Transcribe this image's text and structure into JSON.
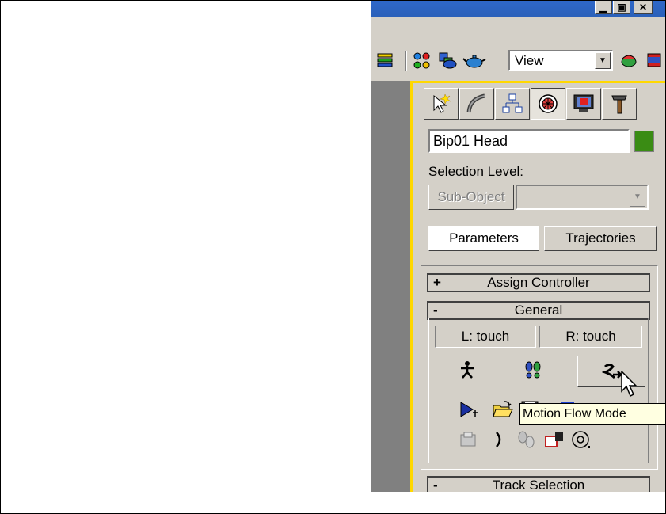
{
  "window": {
    "minimize_glyph": "▁",
    "maximize_glyph": "▣",
    "close_glyph": "✕"
  },
  "toolbar": {
    "view_dropdown": {
      "selected": "View"
    },
    "icons": [
      "layers-icon",
      "schematic-view-icon",
      "material-editor-icon",
      "render-scene-icon",
      "quick-render-icon",
      "render-last-icon"
    ]
  },
  "command_panel": {
    "tabs": [
      "create-tab",
      "modify-tab",
      "hierarchy-tab",
      "motion-tab",
      "display-tab",
      "utilities-tab"
    ],
    "active_tab": "motion-tab",
    "object_name": "Bip01 Head",
    "object_color": "#3a8c14",
    "selection_level_label": "Selection Level:",
    "sub_object_label": "Sub-Object",
    "parameters_label": "Parameters",
    "trajectories_label": "Trajectories",
    "rollouts": {
      "assign_controller": {
        "sign": "+",
        "title": "Assign Controller"
      },
      "general": {
        "sign": "-",
        "title": "General"
      },
      "track_selection": {
        "sign": "-",
        "title": "Track Selection"
      }
    },
    "general": {
      "left_touch": "L: touch",
      "right_touch": "R: touch",
      "mode_icons": [
        "figure-mode-icon",
        "footstep-mode-icon",
        "motion-flow-mode-icon"
      ],
      "file_icons": [
        "play-biped-icon",
        "load-file-icon",
        "save-file-icon",
        "convert-icon",
        "move-all-mode-icon"
      ],
      "misc_icons": [
        "load-bip-icon",
        "bend-links-icon",
        "mixer-icon",
        "biped-playback-icon",
        "in-place-mode-icon"
      ]
    }
  },
  "tooltip": {
    "text": "Motion Flow Mode"
  }
}
